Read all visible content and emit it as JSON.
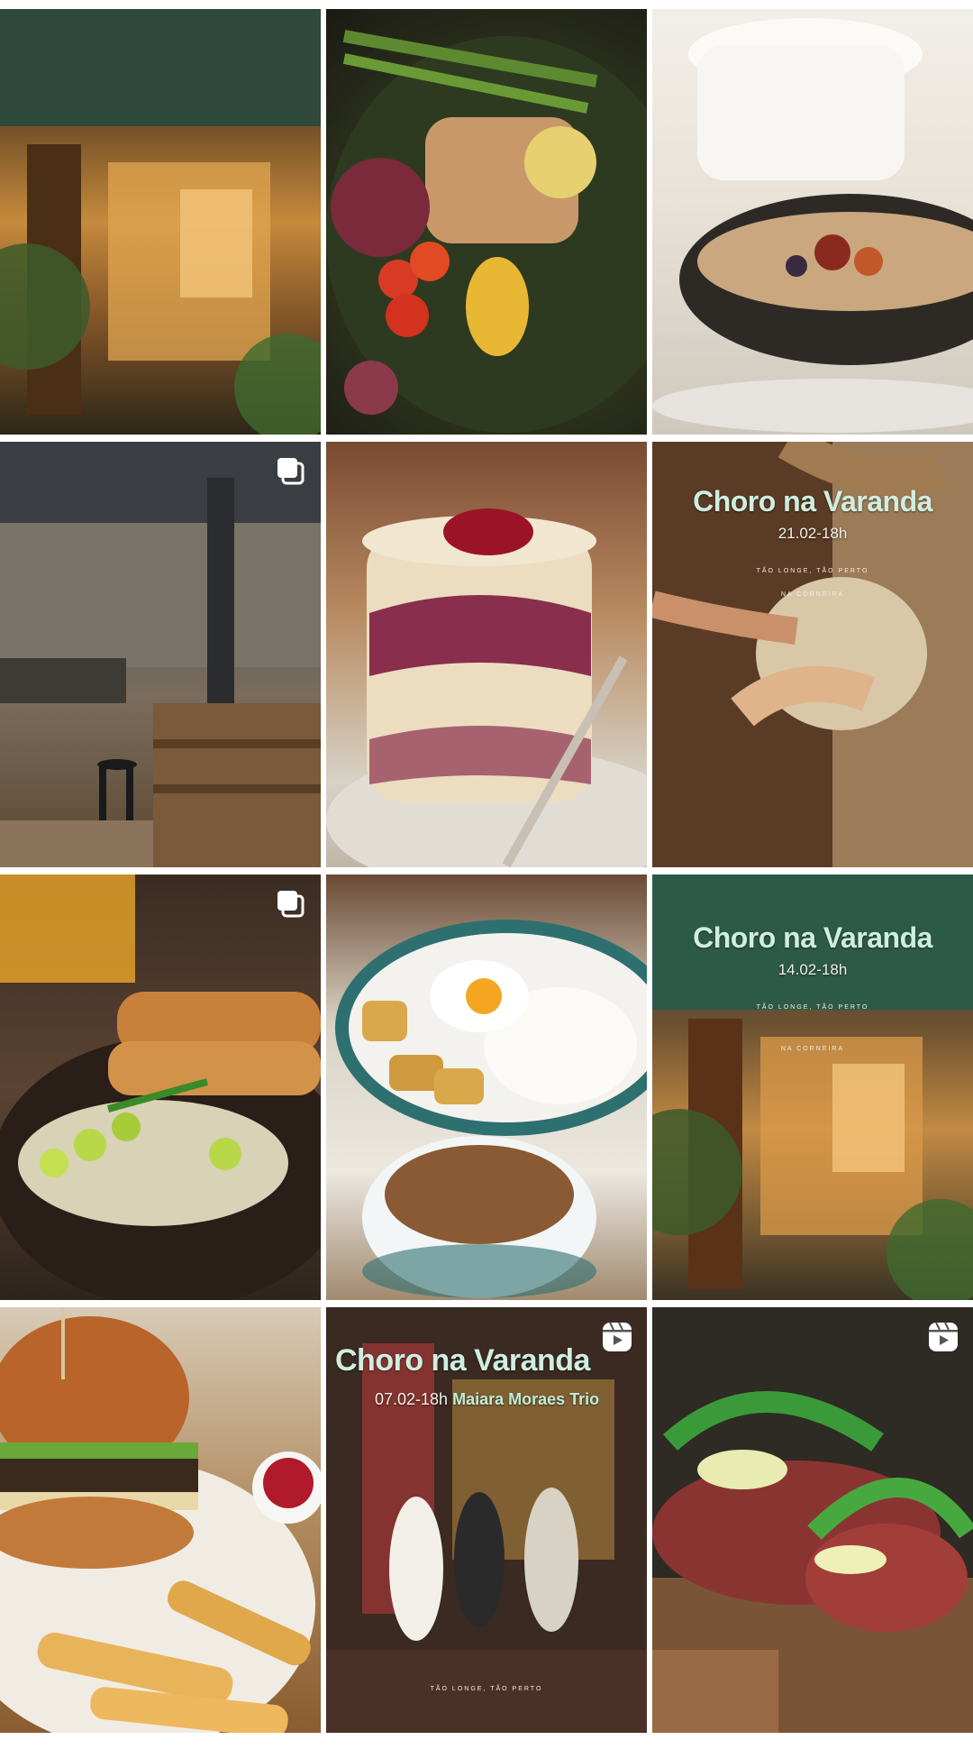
{
  "grid": {
    "tiles": [
      {
        "id": "tile-1",
        "type": null
      },
      {
        "id": "tile-2",
        "type": null
      },
      {
        "id": "tile-3",
        "type": null
      },
      {
        "id": "tile-4",
        "type": "carousel"
      },
      {
        "id": "tile-5",
        "type": null
      },
      {
        "id": "tile-6",
        "type": null,
        "overlay": {
          "title": "Choro na Varanda",
          "date": "21.02-18h",
          "tagline": "TÃO LONGE, TÃO PERTO",
          "venue": "NA CORNEIRA"
        }
      },
      {
        "id": "tile-7",
        "type": "carousel"
      },
      {
        "id": "tile-8",
        "type": null
      },
      {
        "id": "tile-9",
        "type": null,
        "overlay": {
          "title": "Choro na Varanda",
          "date": "14.02-18h",
          "tagline": "TÃO LONGE, TÃO PERTO",
          "venue": "NA CORNEIRA"
        }
      },
      {
        "id": "tile-10",
        "type": null
      },
      {
        "id": "tile-11",
        "type": "reel",
        "overlay": {
          "title": "Choro na Varanda",
          "date": "07.02-18h",
          "artist": "Maiara Moraes Trio",
          "tagline": "TÃO LONGE, TÃO PERTO"
        }
      },
      {
        "id": "tile-12",
        "type": "reel"
      }
    ]
  },
  "colors": {
    "overlay_title": "#cfeee0",
    "overlay_text": "#f4f0e6"
  }
}
